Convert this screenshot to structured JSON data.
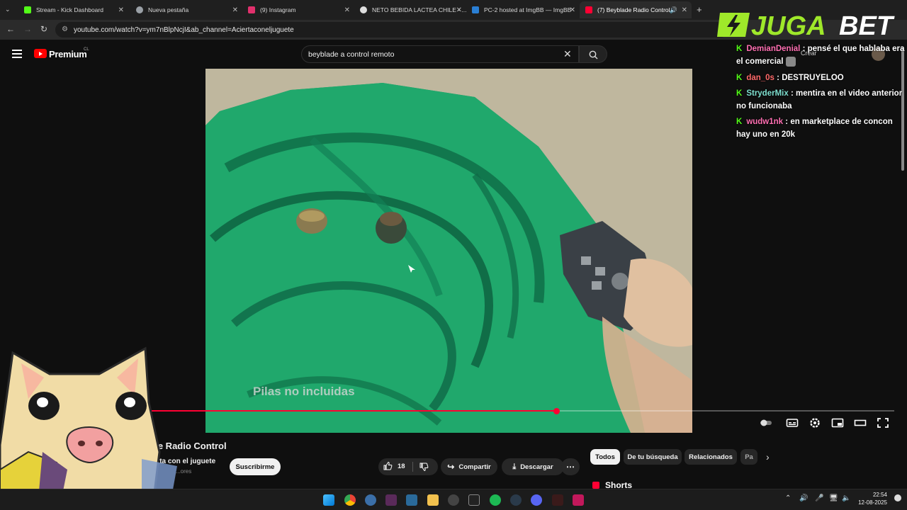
{
  "browser": {
    "tabs": [
      {
        "title": "Stream - Kick Dashboard",
        "color": "#53fc18"
      },
      {
        "title": "Nueva pestaña",
        "color": "#9aa0a6"
      },
      {
        "title": "(9) Instagram",
        "color": "#e1306c"
      },
      {
        "title": "NETO BEBIDA LACTEA CHILE - ...",
        "color": "#dddddd"
      },
      {
        "title": "PC-2 hosted at ImgBB — ImgBB",
        "color": "#2a7fd4"
      },
      {
        "title": "(7) Beyblade Radio Control",
        "color": "#ff0033"
      }
    ],
    "url": "youtube.com/watch?v=ym7nBlpNcjI&ab_channel=Aciertaconeljuguete"
  },
  "youtube": {
    "brand": "Premium",
    "region": "CL",
    "search_query": "beyblade a control remoto",
    "create_label": "Crear"
  },
  "video": {
    "subtitle": "Pilas no incluidas",
    "progress": 0.62,
    "title": "...e Radio Control",
    "channel": "...rta con el juguete",
    "subscribers": "...ores",
    "subscribe_label": "Suscribirme",
    "likes": "18",
    "share_label": "Compartir",
    "download_label": "Descargar"
  },
  "chips": [
    "Todos",
    "De tu búsqueda",
    "Relacionados",
    "Pa"
  ],
  "shorts_label": "Shorts",
  "overlay": {
    "sponsor": "JUGABET",
    "chat": [
      {
        "user": "DemianDenial",
        "color": "#ff6fb2",
        "message": "pensé el que hablaba era el comercial"
      },
      {
        "user": "dan_0s",
        "color": "#ff6a6a",
        "message": "DESTRUYELOO"
      },
      {
        "user": "StryderMix",
        "color": "#7fe0d0",
        "message": "mentira en el video anterior no funcionaba"
      },
      {
        "user": "wudw1nk",
        "color": "#ff6fb2",
        "message": "en marketplace de concon hay uno en 20k"
      }
    ]
  },
  "taskbar": {
    "time": "22:54",
    "date": "12-08-2025"
  }
}
